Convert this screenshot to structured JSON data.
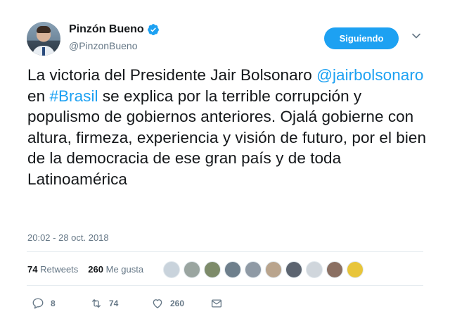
{
  "author": {
    "name": "Pinzón Bueno",
    "handle": "@PinzonBueno",
    "verified": true
  },
  "follow_button": {
    "label": "Siguiendo"
  },
  "tweet": {
    "segments": [
      {
        "text": "La victoria del Presidente Jair Bolsonaro ",
        "link": false
      },
      {
        "text": "@jairbolsonaro",
        "link": true
      },
      {
        "text": " en ",
        "link": false
      },
      {
        "text": "#Brasil",
        "link": true
      },
      {
        "text": " se explica por la terrible corrupción y populismo de gobiernos anteriores. Ojalá gobierne con altura, firmeza, experiencia y visión de futuro, por el bien de la democracia de ese gran país y de toda Latinoamérica",
        "link": false
      }
    ],
    "timestamp": "20:02 - 28 oct. 2018"
  },
  "stats": {
    "retweets_count": "74",
    "retweets_label": "Retweets",
    "likes_count": "260",
    "likes_label": "Me gusta"
  },
  "likers": [
    {
      "color": "#c9d3dc"
    },
    {
      "color": "#9aa5a0"
    },
    {
      "color": "#7d8b6a"
    },
    {
      "color": "#6e7f8c"
    },
    {
      "color": "#8f9aa5"
    },
    {
      "color": "#b9a48d"
    },
    {
      "color": "#5c6470"
    },
    {
      "color": "#d0d6dc"
    },
    {
      "color": "#8a6f62"
    },
    {
      "color": "#e8c53a"
    }
  ],
  "actions": {
    "reply_count": "8",
    "retweet_count": "74",
    "like_count": "260"
  },
  "colors": {
    "accent": "#1da1f2",
    "text": "#14171a",
    "secondary": "#657786",
    "divider": "#e6ecf0"
  }
}
